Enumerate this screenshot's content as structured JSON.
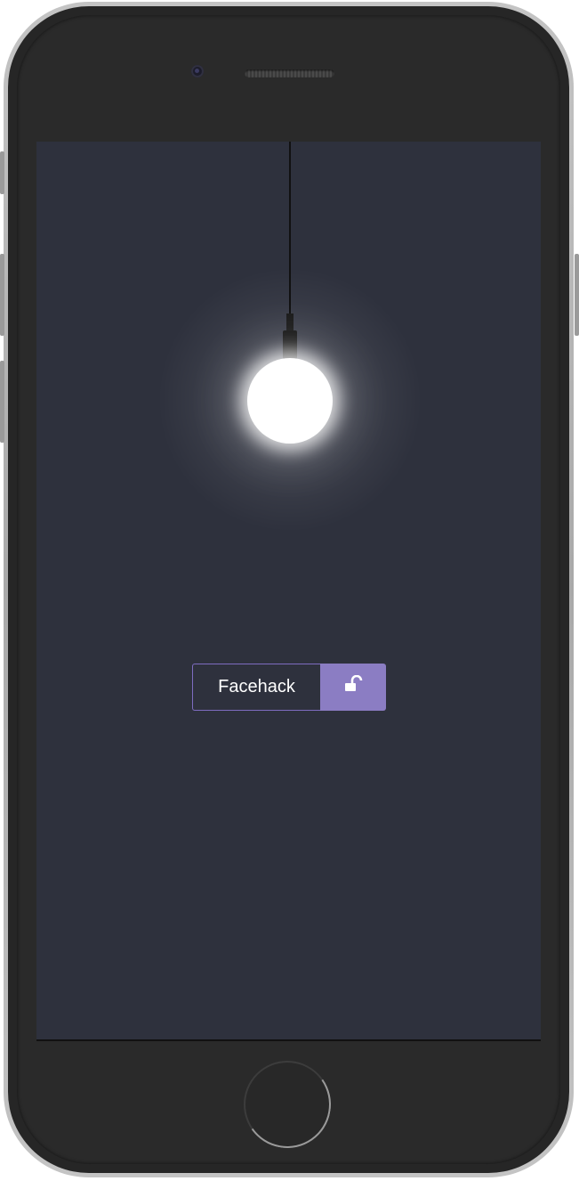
{
  "lock": {
    "name_value": "Facehack",
    "button_icon": "unlock-icon",
    "accent_color": "#8b7dc3"
  },
  "lamp": {
    "state": "on"
  },
  "device": {
    "frame_color": "#262626",
    "screen_color": "#2e313d"
  }
}
